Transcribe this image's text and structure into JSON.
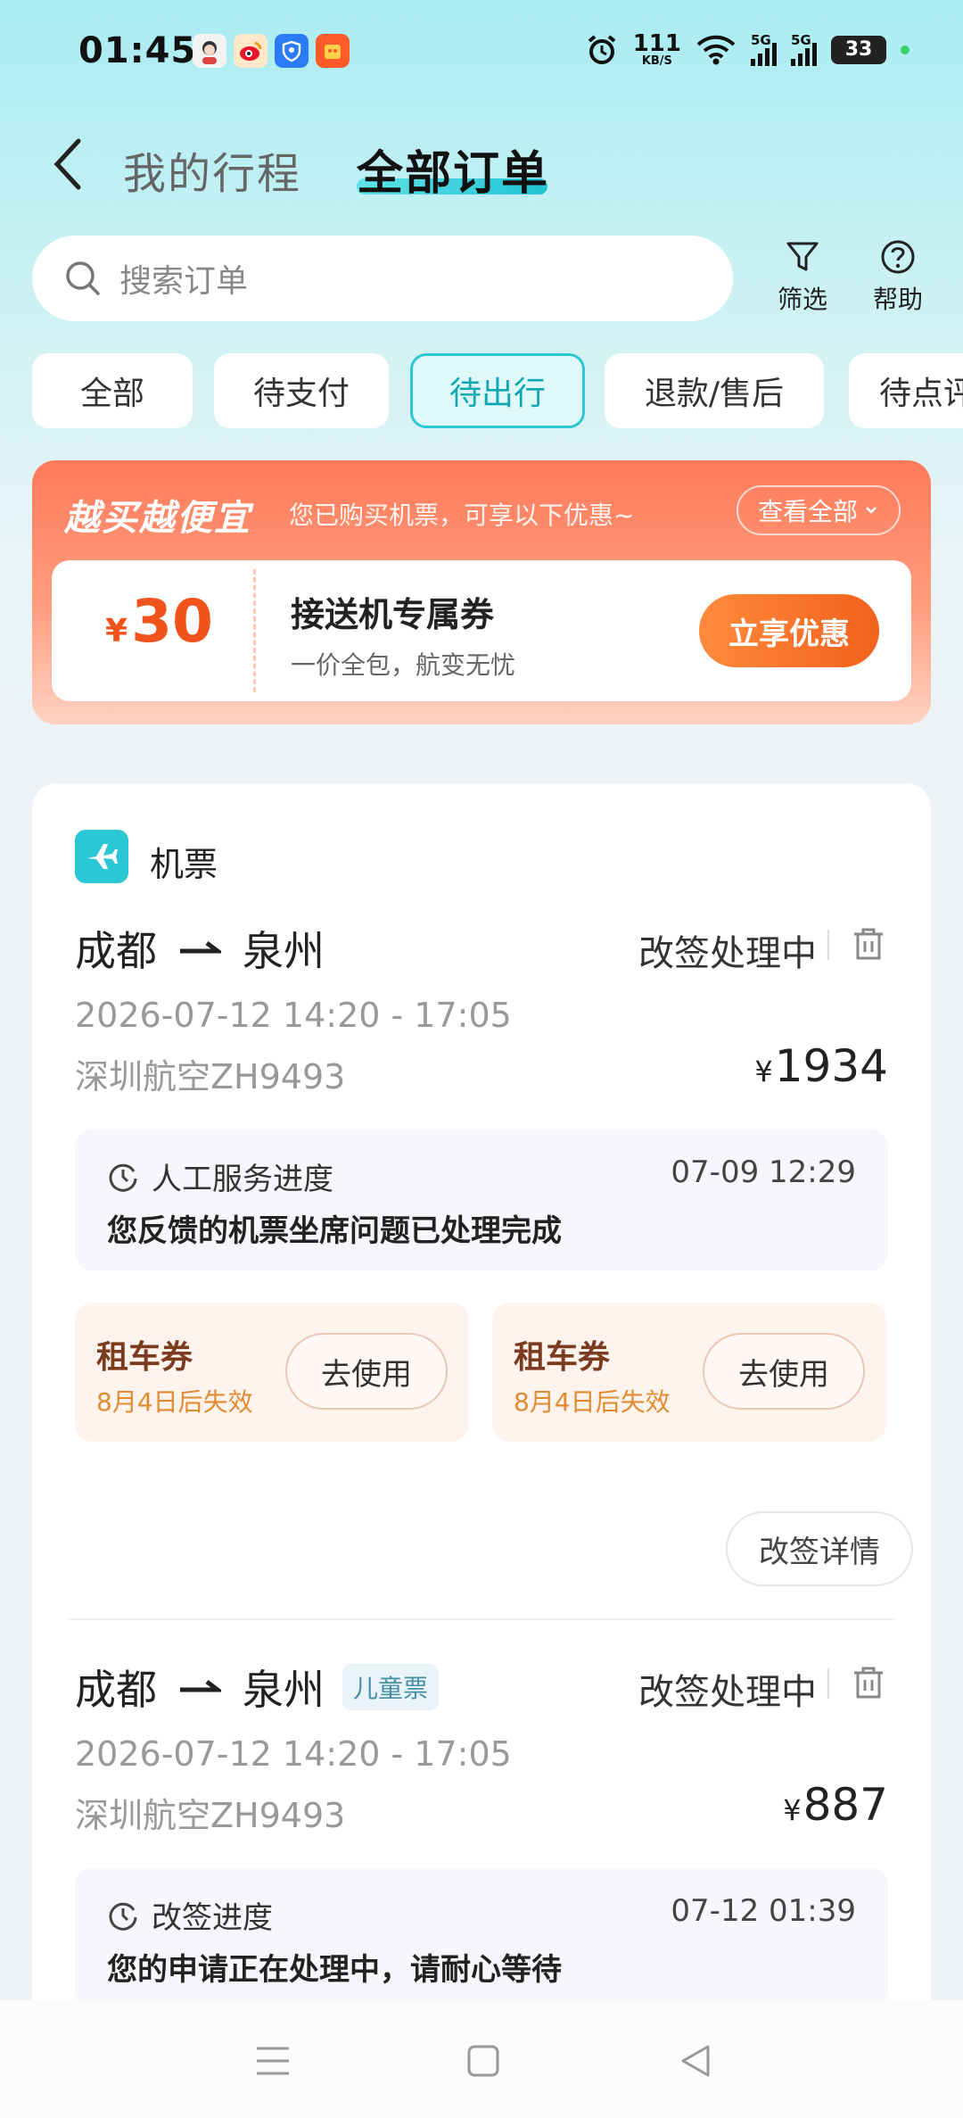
{
  "status_bar": {
    "time": "01:45",
    "net_speed_value": "111",
    "net_speed_unit": "KB/S",
    "signal_1": "5G",
    "signal_2": "5G",
    "battery": "33"
  },
  "header": {
    "tab_my_trips": "我的行程",
    "tab_all_orders": "全部订单"
  },
  "search": {
    "placeholder": "搜索订单",
    "filter_label": "筛选",
    "help_label": "帮助"
  },
  "filters": [
    {
      "label": "全部",
      "active": false
    },
    {
      "label": "待支付",
      "active": false
    },
    {
      "label": "待出行",
      "active": true
    },
    {
      "label": "退款/售后",
      "active": false
    },
    {
      "label": "待点评",
      "active": false
    }
  ],
  "promo": {
    "title": "越买越便宜",
    "subtitle": "您已购买机票，可享以下优惠~",
    "view_all": "查看全部",
    "coupon_currency": "¥",
    "coupon_amount": "30",
    "coupon_title": "接送机专属券",
    "coupon_desc": "一价全包，航变无忧",
    "coupon_button": "立享优惠"
  },
  "order": {
    "category": "机票",
    "tickets": [
      {
        "from": "成都",
        "to": "泉州",
        "tag": "",
        "status": "改签处理中",
        "datetime": "2026-07-12 14:20 - 17:05",
        "flight": "深圳航空ZH9493",
        "currency": "¥",
        "price": "1934",
        "progress_title": "人工服务进度",
        "progress_time": "07-09 12:29",
        "progress_msg": "您反馈的机票坐席问题已处理完成"
      },
      {
        "from": "成都",
        "to": "泉州",
        "tag": "儿童票",
        "status": "改签处理中",
        "datetime": "2026-07-12 14:20 - 17:05",
        "flight": "深圳航空ZH9493",
        "currency": "¥",
        "price": "887",
        "progress_title": "改签进度",
        "progress_time": "07-12 01:39",
        "progress_msg": "您的申请正在处理中，请耐心等待"
      }
    ],
    "rental_coupons": [
      {
        "title": "租车券",
        "expiry": "8月4日后失效",
        "button": "去使用"
      },
      {
        "title": "租车券",
        "expiry": "8月4日后失效",
        "button": "去使用"
      }
    ],
    "detail_button": "改签详情"
  },
  "colors": {
    "accent": "#2dc7d3",
    "promo": "#ff7a5a",
    "coupon_orange": "#f2621c"
  }
}
